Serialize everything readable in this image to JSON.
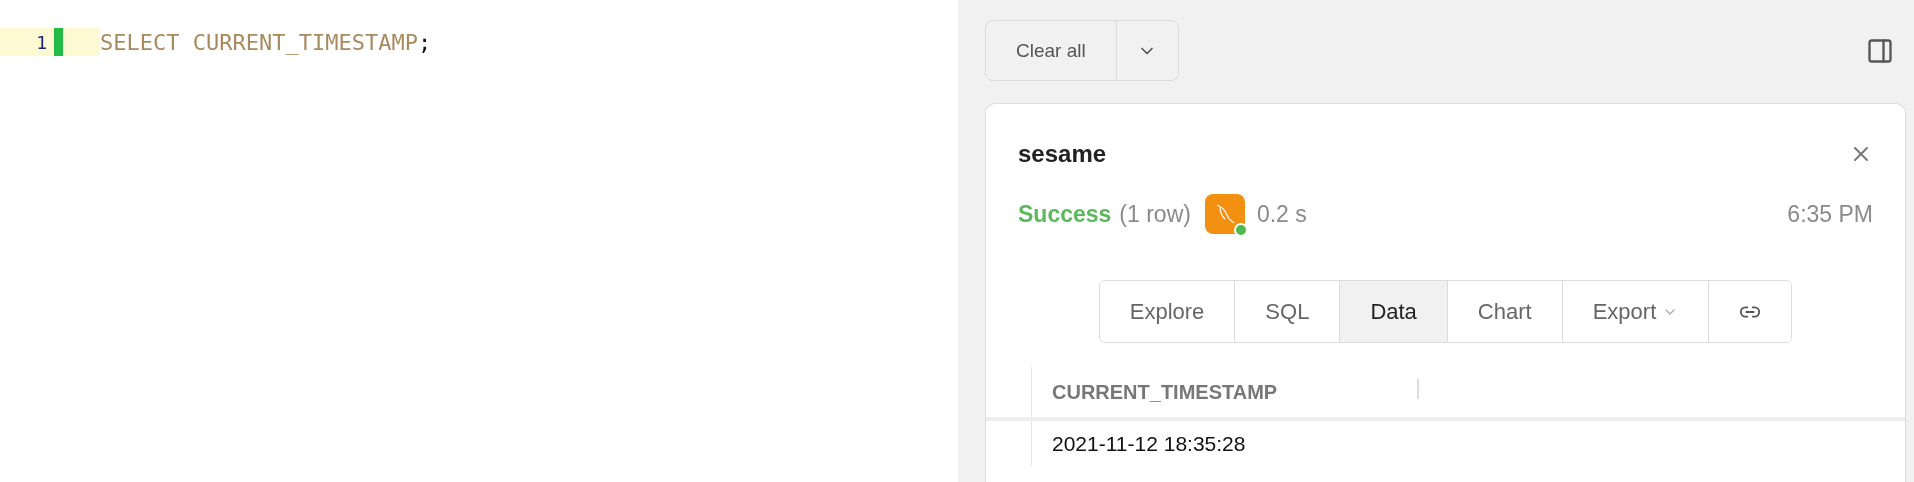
{
  "editor": {
    "lines": [
      {
        "number": "1",
        "keyword": "SELECT CURRENT_TIMESTAMP",
        "punct": ";",
        "active": true
      }
    ]
  },
  "toolbar": {
    "clear_button": "Clear all"
  },
  "result": {
    "title": "sesame",
    "status": "Success",
    "rows": "(1 row)",
    "duration": "0.2 s",
    "time": "6:35 PM",
    "tabs": [
      {
        "label": "Explore",
        "selected": false,
        "kind": "text"
      },
      {
        "label": "SQL",
        "selected": false,
        "kind": "text"
      },
      {
        "label": "Data",
        "selected": true,
        "kind": "text"
      },
      {
        "label": "Chart",
        "selected": false,
        "kind": "text"
      },
      {
        "label": "Export",
        "selected": false,
        "kind": "menu"
      },
      {
        "selected": false,
        "kind": "link"
      }
    ],
    "table": {
      "columns": [
        "CURRENT_TIMESTAMP"
      ],
      "rows": [
        [
          "2021-11-12 18:35:28"
        ]
      ]
    }
  }
}
